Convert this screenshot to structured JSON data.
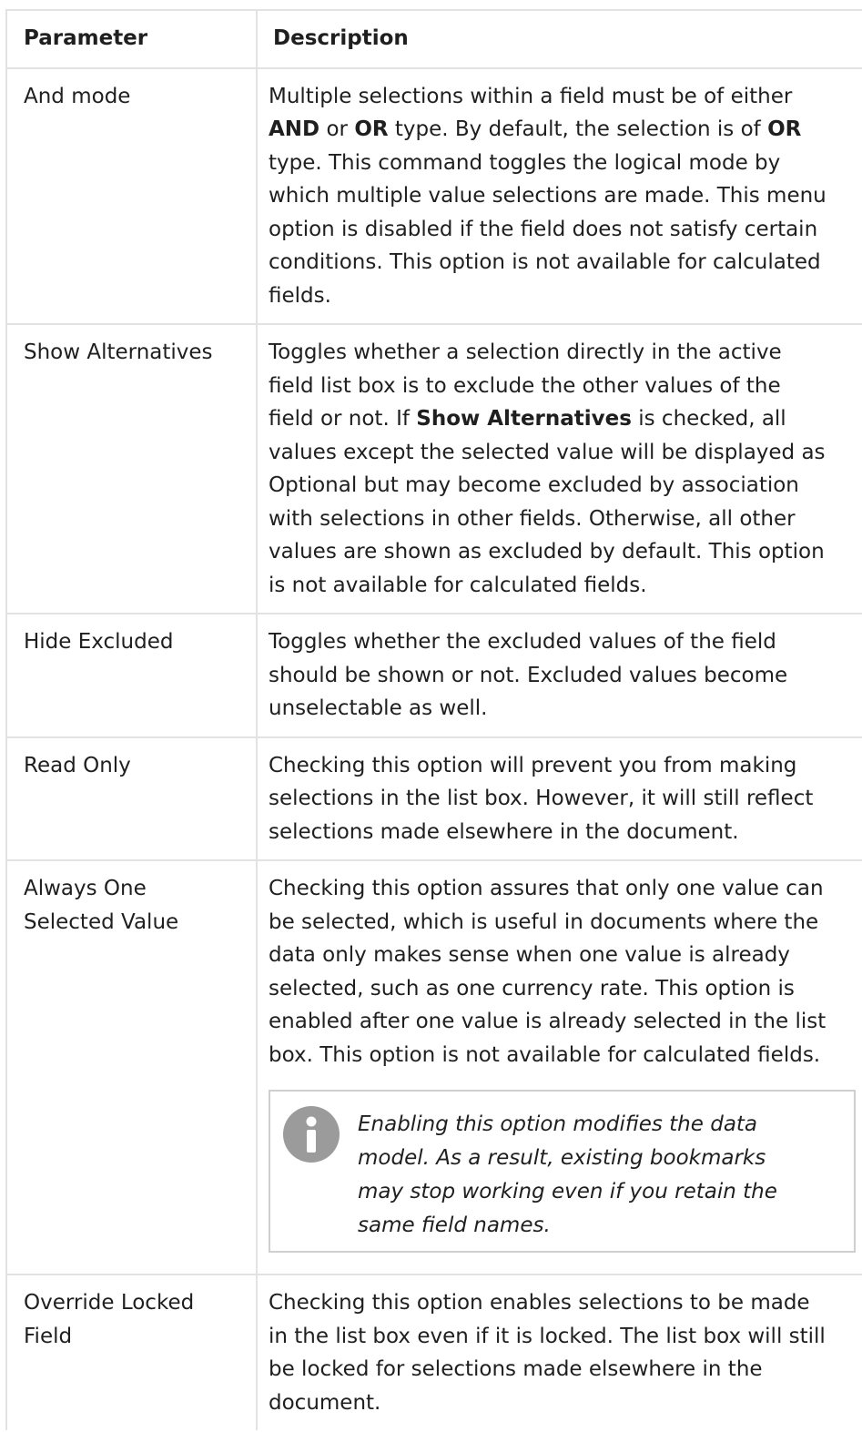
{
  "table": {
    "header": {
      "parameter": "Parameter",
      "description": "Description"
    },
    "rows": [
      {
        "parameter_lines": [
          "And mode"
        ],
        "description_html": [
          "Multiple selections within a field must be of either",
          "<b>AND</b> or <b>OR</b> type. By default, the selection is of <b>OR</b>",
          "type. This command toggles the logical mode by",
          "which multiple value selections are made. This menu",
          "option is disabled if the field does not satisfy certain",
          "conditions. This option is not available for calculated",
          "fields."
        ]
      },
      {
        "parameter_lines": [
          "Show Alternatives"
        ],
        "description_html": [
          "Toggles whether a selection directly in the active",
          "field list box is to exclude the other values of the",
          "field or not. If <b>Show Alternatives</b> is checked, all",
          "values except the selected value will be displayed as",
          "Optional but may become excluded by association",
          "with selections in other fields. Otherwise, all other",
          "values are shown as excluded by default. This option",
          "is not available for calculated fields."
        ]
      },
      {
        "parameter_lines": [
          "Hide Excluded"
        ],
        "description_html": [
          "Toggles whether the excluded values of the field",
          "should be shown or not. Excluded values become",
          "unselectable as well."
        ]
      },
      {
        "parameter_lines": [
          "Read Only"
        ],
        "description_html": [
          "Checking this option will prevent you from making",
          "selections in the list box. However, it will still reflect",
          "selections made elsewhere in the document."
        ]
      },
      {
        "parameter_lines": [
          "Always One",
          "Selected Value"
        ],
        "description_html": [
          "Checking this option assures that only one value can",
          "be selected, which is useful in documents where the",
          "data only makes sense when one value is already",
          "selected, such as one currency rate. This option is",
          "enabled after one value is already selected in the list",
          "box. This option is not available for calculated fields."
        ],
        "note": {
          "icon": "info-icon",
          "lines": [
            "Enabling this option modifies the data",
            "model. As a result, existing bookmarks",
            "may stop working even if you retain the",
            "same field names."
          ]
        }
      },
      {
        "parameter_lines": [
          "Override Locked",
          "Field"
        ],
        "description_html": [
          "Checking this option enables selections to be made",
          "in the list box even if it is locked. The list box will still",
          "be locked for selections made elsewhere in the",
          "document."
        ]
      }
    ]
  }
}
